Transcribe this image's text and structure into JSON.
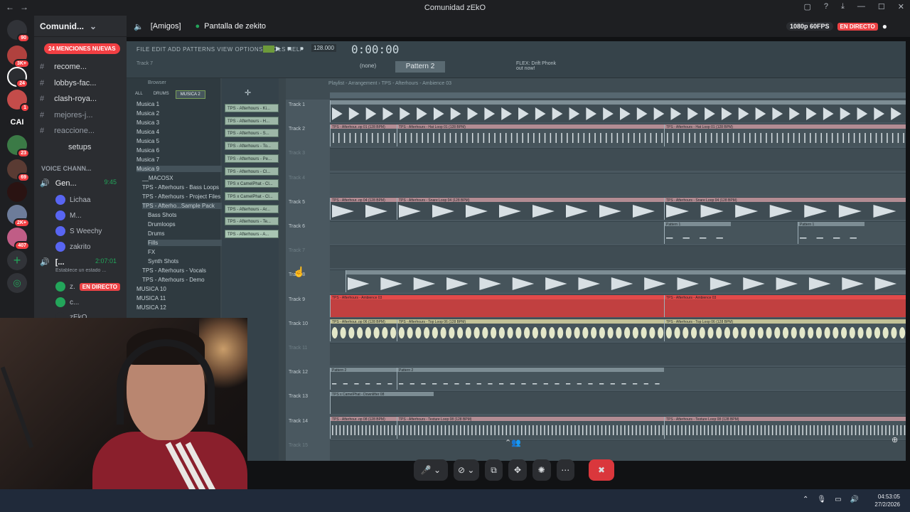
{
  "window": {
    "title": "Comunidad zEkO",
    "nav_back": "←",
    "nav_fwd": "→"
  },
  "servers": [
    {
      "badge": "90"
    },
    {
      "badge": "3K+"
    },
    {
      "badge": "24"
    },
    {
      "badge": "1"
    },
    {
      "label": "CAI"
    },
    {
      "badge": "23"
    },
    {
      "badge": "69"
    },
    {
      "badge": ""
    },
    {
      "badge": "2K+"
    },
    {
      "badge": "407"
    }
  ],
  "sidebar": {
    "server_name": "Comunid...",
    "mentions": "24 MENCIONES NUEVAS",
    "channels": [
      {
        "label": "recome..."
      },
      {
        "label": "lobbys-fac..."
      },
      {
        "label": "clash-roya..."
      },
      {
        "label": "mejores-j..."
      },
      {
        "label": "reaccione..."
      },
      {
        "label": "setups"
      }
    ],
    "voice_header": "VOICE CHANN...",
    "voice_channel": "Gen...",
    "voice_time": "9:45",
    "voice_users": [
      "Lichaa",
      "M...",
      "S Weechy",
      "zakrito"
    ],
    "live_channel": "[...",
    "live_time": "2:07:01",
    "status_hint": "Establece un estado ...",
    "live_user": "z.",
    "live_label": "EN DIRECTO",
    "user_c": "c...",
    "user_zeko": "zEkO"
  },
  "call": {
    "channel": "[Amigos]",
    "screen_share": "Pantalla de zekito",
    "quality": "1080p 60FPS",
    "live": "EN DIRECTO"
  },
  "fl": {
    "menu": "FILE  EDIT  ADD  PATTERNS  VIEW  OPTIONS  TOOLS  HELP",
    "time": "0:00:00",
    "tempo": "128.000",
    "pattern": "Pattern 2",
    "snap": "(none)",
    "plugin": "FLEX: Drift Phonk",
    "plugin_sub": "out now!",
    "hint": "Track 7",
    "browser_title": "Browser",
    "browser_tabs": [
      "ALL",
      "DRUMS",
      "MUSICA 2"
    ],
    "browser_items": [
      "Musica 1",
      "Musica 2",
      "Musica 3",
      "Musica 4",
      "Musica 5",
      "Musica 6",
      "Musica 7",
      "Musica 9",
      "__MACOSX",
      "TPS - Afterhours - Bass Loops",
      "TPS - Afterhours - Project Files",
      "TPS - Afterho...Sample Pack",
      "Bass Shots",
      "Drumloops",
      "Drums",
      "Fills",
      "FX",
      "Synth Shots",
      "TPS - Afterhours - Vocals",
      "TPS - Afterhours - Demo",
      "MUSICA 10",
      "MUSICA 11",
      "MUSICA 12"
    ],
    "channel_rack": [
      "TPS - Afterhours - Ki...",
      "TPS - Afterhours - H...",
      "TPS - Afterhours - S...",
      "TPS - Afterhours - To...",
      "TPS - Afterhours - Pe...",
      "TPS - Afterhours - Cl...",
      "TPS x CamelPhat - Cl...",
      "TPS x CamelPhat - Cl...",
      "TPS - Afterhours - Ar...",
      "TPS - Afterhours - Te...",
      "TPS - Afterhours - A..."
    ],
    "playlist_title": "Playlist - Arrangement › TPS - Afterhours - Ambience 03",
    "tracks": [
      {
        "name": "Track 1",
        "clips": []
      },
      {
        "name": "Track 2",
        "clips": [
          "TPS - Afterhour..op 01 (128 BPM)",
          "TPS - Afterhours - Hat Loop 01 (128 BPM)",
          "TPS - Afterhours - Hat Loop 01 (128 BPM)"
        ]
      },
      {
        "name": "Track 3",
        "clips": []
      },
      {
        "name": "Track 4",
        "clips": []
      },
      {
        "name": "Track 5",
        "clips": [
          "TPS - Afterhour..op 04 (128 BPM)",
          "TPS - Afterhours - Snare Loop 04 (128 BPM)",
          "TPS - Afterhours - Snare Loop 04 (128 BPM)"
        ]
      },
      {
        "name": "Track 6",
        "clips": [
          "Pattern 1",
          "Pattern 1"
        ]
      },
      {
        "name": "Track 7",
        "clips": []
      },
      {
        "name": "Track 8",
        "clips": []
      },
      {
        "name": "Track 9",
        "clips": [
          "TPS - Afterhours - Ambience 03",
          "TPS - Afterhours - Ambience 03"
        ]
      },
      {
        "name": "Track 10",
        "clips": [
          "TPS - Afterhour..op 06 (128 BPM)",
          "TPS - Afterhours - Top Loop 06 (128 BPM)",
          "TPS - Afterhours - Top Loop 06 (128 BPM)"
        ]
      },
      {
        "name": "Track 11",
        "clips": []
      },
      {
        "name": "Track 12",
        "clips": [
          "Pattern 2",
          "Pattern 2"
        ]
      },
      {
        "name": "Track 13",
        "clips": [
          "TPS x CamelPhat - Downlifter 08"
        ]
      },
      {
        "name": "Track 14",
        "clips": [
          "TPS - Afterhour..op 08 (128 BPM)",
          "TPS - Afterhours - Texture Loop 08 (128 BPM)",
          "TPS - Afterhours - Texture Loop 08 (128 BPM)"
        ]
      },
      {
        "name": "Track 15",
        "clips": []
      }
    ]
  },
  "taskbar": {
    "time": "04:53:05",
    "date": "27/2/2026"
  },
  "colors": {
    "accent_live": "#ed4245",
    "discord_bg": "#1e1f22",
    "fl_bg": "#3a464c",
    "ambience_clip": "#e24a4a"
  }
}
